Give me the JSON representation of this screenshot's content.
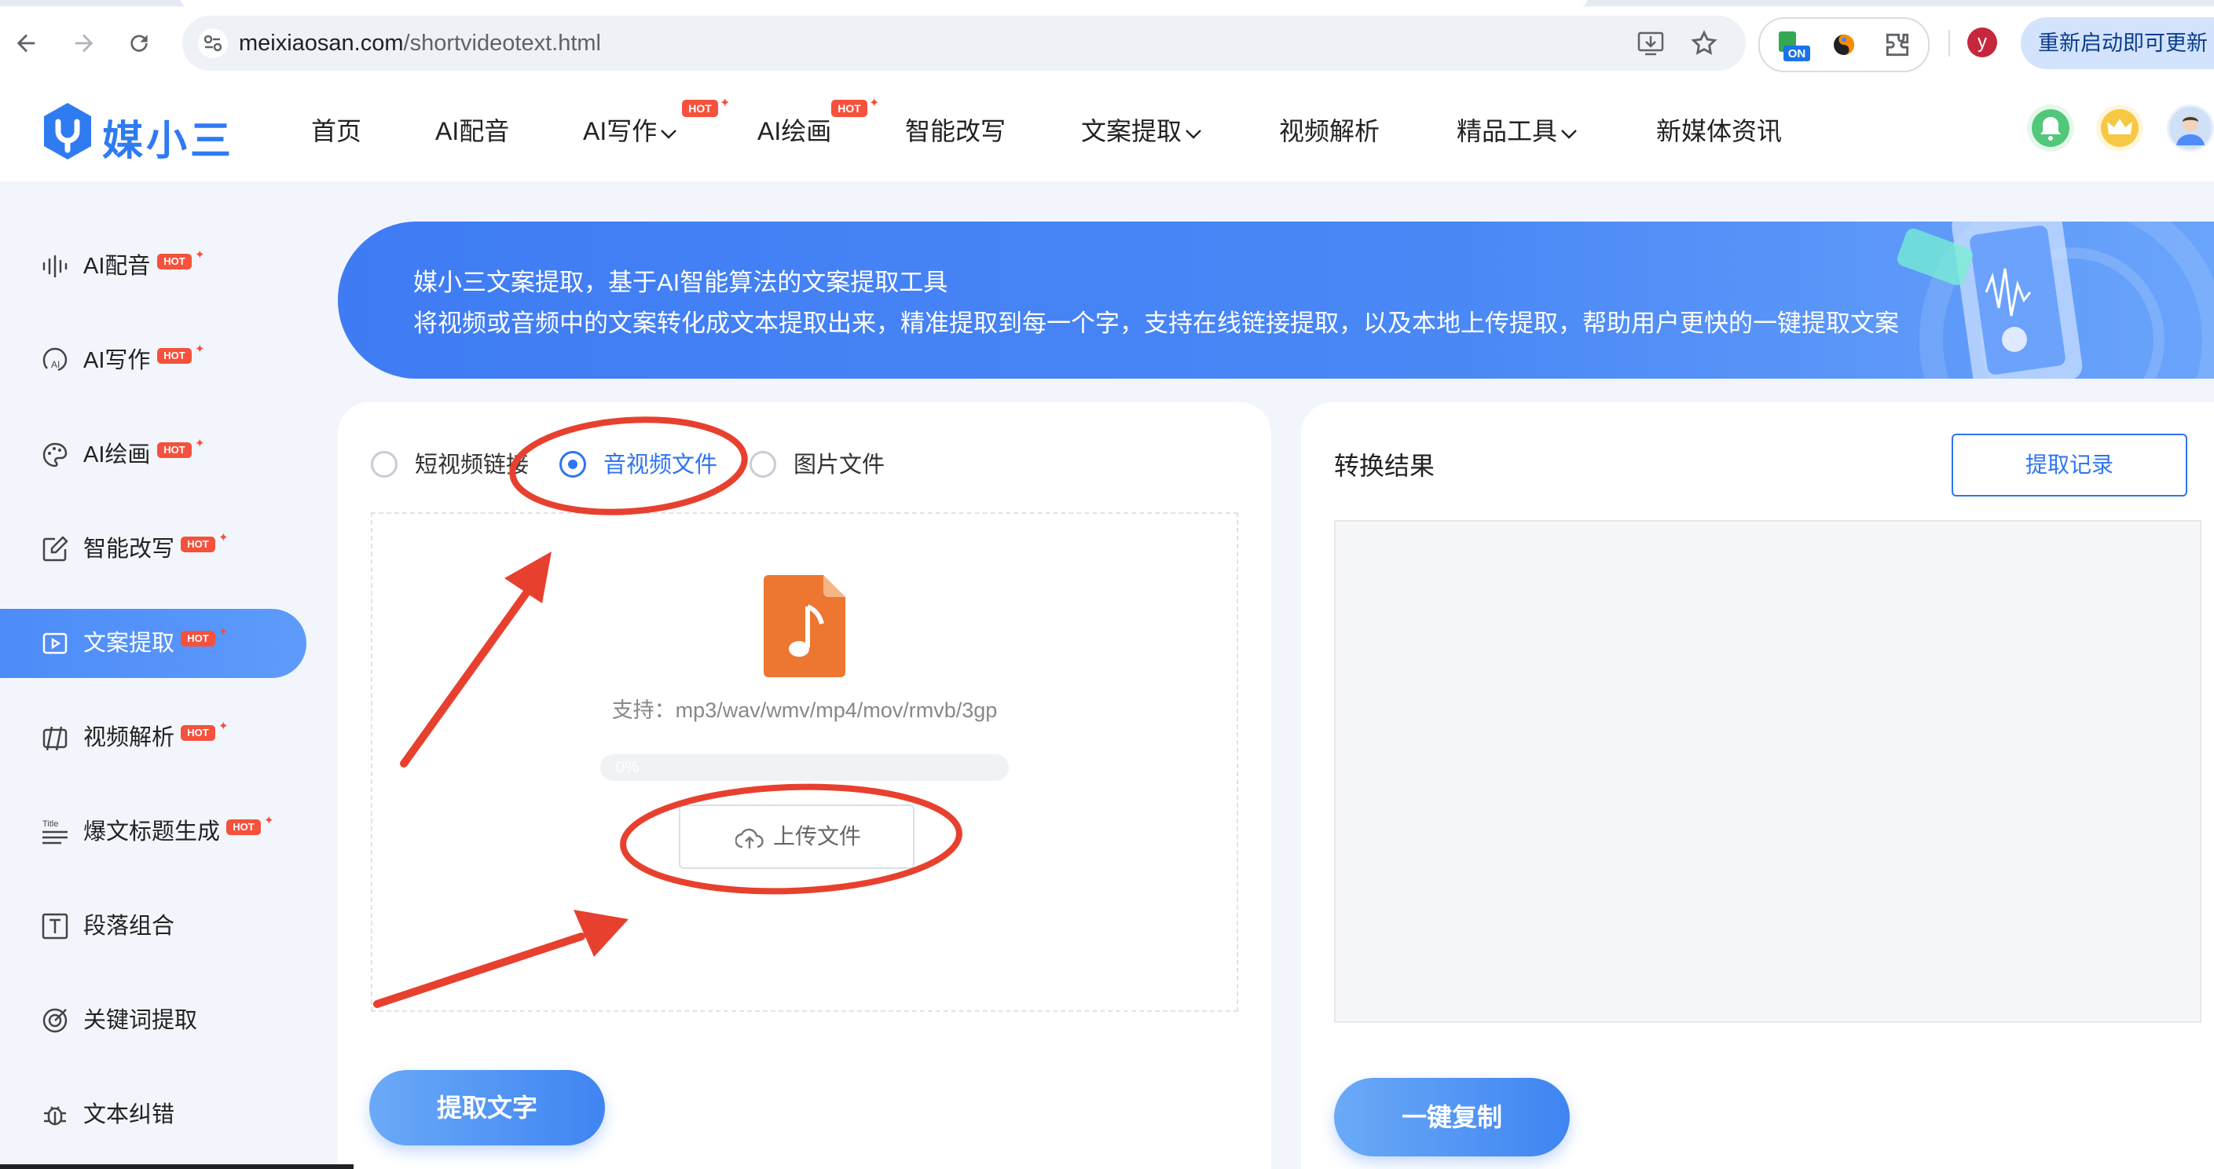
{
  "browser": {
    "url_host": "meixiaosan.com",
    "url_path": "/shortvideotext.html",
    "profile_initial": "y",
    "update_button": "重新启动即可更新",
    "ext_badge": "ON"
  },
  "site": {
    "logo_text": "媒小三",
    "nav": [
      {
        "label": "首页"
      },
      {
        "label": "AI配音"
      },
      {
        "label": "AI写作",
        "hot": "HOT"
      },
      {
        "label": "AI绘画",
        "hot": "HOT"
      },
      {
        "label": "智能改写"
      },
      {
        "label": "文案提取"
      },
      {
        "label": "视频解析"
      },
      {
        "label": "精品工具"
      },
      {
        "label": "新媒体资讯"
      }
    ],
    "hot_badge": "HOT"
  },
  "sidebar": {
    "items": [
      {
        "label": "AI配音",
        "icon": "waveform-icon",
        "hot": true
      },
      {
        "label": "AI写作",
        "icon": "ai-write-icon",
        "hot": true
      },
      {
        "label": "AI绘画",
        "icon": "palette-icon",
        "hot": true
      },
      {
        "label": "智能改写",
        "icon": "edit-icon",
        "hot": true
      },
      {
        "label": "文案提取",
        "icon": "video-text-icon",
        "hot": true,
        "active": true
      },
      {
        "label": "视频解析",
        "icon": "video-parse-icon",
        "hot": true
      },
      {
        "label": "爆文标题生成",
        "icon": "title-icon",
        "hot": true
      },
      {
        "label": "段落组合",
        "icon": "text-box-icon",
        "hot": false
      },
      {
        "label": "关键词提取",
        "icon": "target-icon",
        "hot": false
      },
      {
        "label": "文本纠错",
        "icon": "bug-icon",
        "hot": false
      }
    ]
  },
  "banner": {
    "line1": "媒小三文案提取，基于AI智能算法的文案提取工具",
    "line2": "将视频或音频中的文案转化成文本提取出来，精准提取到每一个字，支持在线链接提取，以及本地上传提取，帮助用户更快的一键提取文案"
  },
  "extract": {
    "options": [
      {
        "label": "短视频链接",
        "selected": false
      },
      {
        "label": "音视频文件",
        "selected": true
      },
      {
        "label": "图片文件",
        "selected": false
      }
    ],
    "support_text": "支持：mp3/wav/wmv/mp4/mov/rmvb/3gp",
    "progress": 0,
    "progress_text": "0%",
    "upload_label": "上传文件",
    "extract_button": "提取文字"
  },
  "result": {
    "title": "转换结果",
    "record_button": "提取记录",
    "content": "",
    "copy_button": "一键复制"
  },
  "colors": {
    "primary": "#2f74f2",
    "hot": "#f5513c",
    "annotation": "#e8402e"
  }
}
